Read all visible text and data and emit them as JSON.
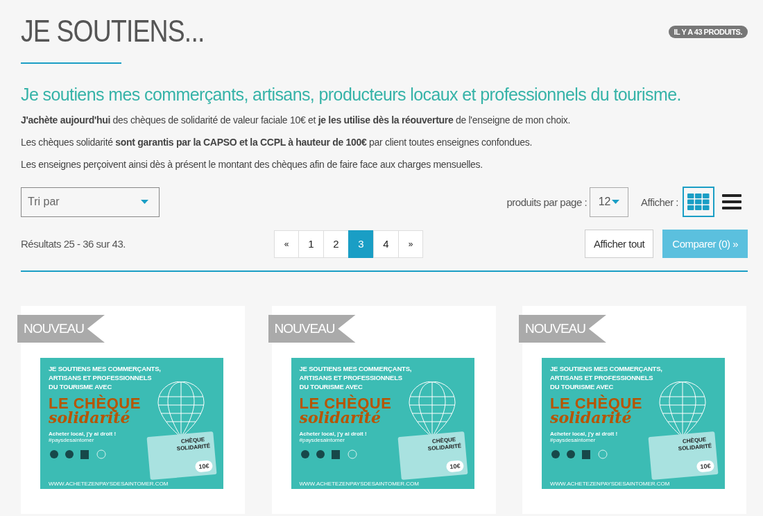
{
  "page_title": "JE SOUTIENS...",
  "product_count_badge": "IL Y A 43 PRODUITS.",
  "subtitle": "Je soutiens mes commerçants, artisans, producteurs locaux et professionnels du tourisme.",
  "paragraphs": [
    "**J'achète aujourd'hui** des chèques de solidarité de valeur faciale 10€ et **je les utilise dès la réouverture** de l'enseigne de mon choix.",
    "Les chèques solidarité **sont garantis par la CAPSO et la CCPL à hauteur de 100€** par client toutes enseignes confondues.",
    "Les enseignes perçoivent ainsi dès à présent le montant des chèques afin de faire face aux charges mensuelles."
  ],
  "sort_select": {
    "value": "Tri par"
  },
  "per_page": {
    "label": "produits par page :",
    "value": "12"
  },
  "view_toggle": {
    "label": "Afficher :",
    "options": [
      {
        "kind": "grid",
        "selected": true
      },
      {
        "kind": "list",
        "selected": false
      }
    ]
  },
  "results_text": "Résultats 25 - 36 sur 43.",
  "pagination": [
    {
      "label": "«",
      "selected": false
    },
    {
      "label": "1",
      "selected": false
    },
    {
      "label": "2",
      "selected": false
    },
    {
      "label": "3",
      "selected": true
    },
    {
      "label": "4",
      "selected": false
    },
    {
      "label": "»",
      "selected": false
    }
  ],
  "show_all_button": "Afficher tout",
  "compare_button": "Comparer (0) »",
  "products": [
    {
      "ribbon": "NOUVEAU",
      "image": {
        "headline": [
          "JE SOUTIENS MES COMMERÇANTS,",
          "ARTISANS ET PROFESSIONNELS",
          "DU TOURISME AVEC"
        ],
        "title": "LE CHÈQUE",
        "script": "solidarité",
        "slogan": "Acheter local, j'y ai droit !",
        "hashtag": "#paysdesaintomer",
        "card_title": "CHÈQUE SOLIDARITÉ",
        "card_value": "10€",
        "url": "WWW.ACHETEZENPAYSDESAINTOMER.COM"
      }
    },
    {
      "ribbon": "NOUVEAU",
      "image": {
        "headline": [
          "JE SOUTIENS MES COMMERÇANTS,",
          "ARTISANS ET PROFESSIONNELS",
          "DU TOURISME AVEC"
        ],
        "title": "LE CHÈQUE",
        "script": "solidarité",
        "slogan": "Acheter local, j'y ai droit !",
        "hashtag": "#paysdesaintomer",
        "card_title": "CHÈQUE SOLIDARITÉ",
        "card_value": "10€",
        "url": "WWW.ACHETEZENPAYSDESAINTOMER.COM"
      }
    },
    {
      "ribbon": "NOUVEAU",
      "image": {
        "headline": [
          "JE SOUTIENS MES COMMERÇANTS,",
          "ARTISANS ET PROFESSIONNELS",
          "DU TOURISME AVEC"
        ],
        "title": "LE CHÈQUE",
        "script": "solidarité",
        "slogan": "Acheter local, j'y ai droit !",
        "hashtag": "#paysdesaintomer",
        "card_title": "CHÈQUE SOLIDARITÉ",
        "card_value": "10€",
        "url": "WWW.ACHETEZENPAYSDESAINTOMER.COM"
      }
    }
  ]
}
